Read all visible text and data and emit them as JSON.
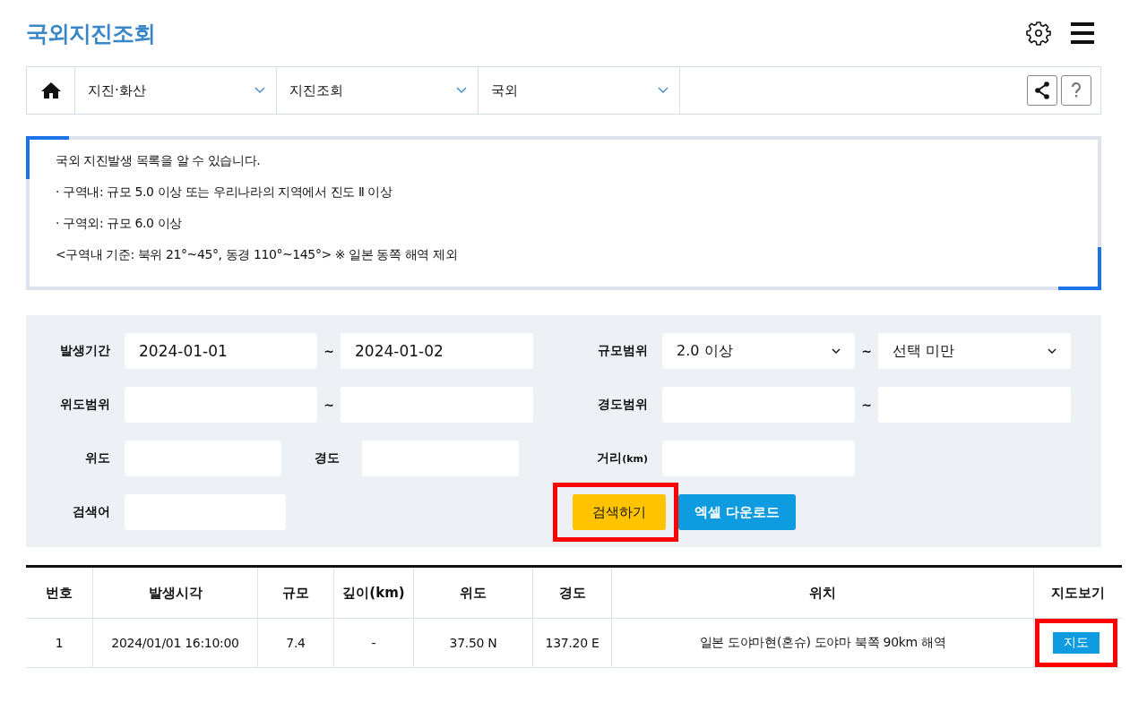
{
  "header": {
    "title": "국외지진조회"
  },
  "breadcrumb": [
    {
      "label": "지진·화산"
    },
    {
      "label": "지진조회"
    },
    {
      "label": "국외"
    }
  ],
  "info": {
    "lines": [
      "국외 지진발생 목록을 알 수 있습니다.",
      "· 구역내: 규모 5.0 이상 또는 우리나라의 지역에서 진도 Ⅱ 이상",
      "· 구역외: 규모 6.0 이상",
      "<구역내 기준: 북위 21°~45°, 동경 110°~145°> ※ 일본 동쪽 해역 제외"
    ]
  },
  "search": {
    "period": {
      "label": "발생기간",
      "from": "2024-01-01",
      "sep": "~",
      "to": "2024-01-02"
    },
    "magnitude": {
      "label": "규모범위",
      "from": "2.0 이상",
      "sep": "~",
      "to": "선택 미만"
    },
    "lat_range": {
      "label": "위도범위",
      "sep": "~"
    },
    "lon_range": {
      "label": "경도범위",
      "sep": "~"
    },
    "lat": {
      "label": "위도"
    },
    "lon": {
      "label": "경도"
    },
    "distance": {
      "label": "거리",
      "unit": "(km)"
    },
    "keyword": {
      "label": "검색어"
    },
    "buttons": [
      {
        "kind": "search",
        "label": "검색하기",
        "highlighted": true
      },
      {
        "kind": "excel",
        "label": "엑셀 다운로드",
        "highlighted": false
      }
    ]
  },
  "table": {
    "columns": [
      "번호",
      "발생시각",
      "규모",
      "깊이(km)",
      "위도",
      "경도",
      "위치",
      "지도보기"
    ],
    "rows": [
      {
        "cells": [
          "1",
          "2024/01/01 16:10:00",
          "7.4",
          "-",
          "37.50 N",
          "137.20 E",
          "일본 도야마현(혼슈) 도야마 북쪽 90km 해역"
        ],
        "map_button": "지도",
        "highlighted": true
      }
    ]
  }
}
